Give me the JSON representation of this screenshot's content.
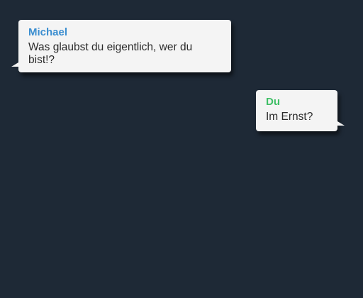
{
  "colors": {
    "background": "#1e2936",
    "bubble": "#f4f4f4",
    "sender_michael": "#3b8ed0",
    "sender_you": "#3fbf66"
  },
  "messages": [
    {
      "sender": "Michael",
      "text": "Was glaubst du eigentlich, wer du bist!?",
      "side": "left"
    },
    {
      "sender": "Du",
      "text": "Im Ernst?",
      "side": "right"
    }
  ]
}
